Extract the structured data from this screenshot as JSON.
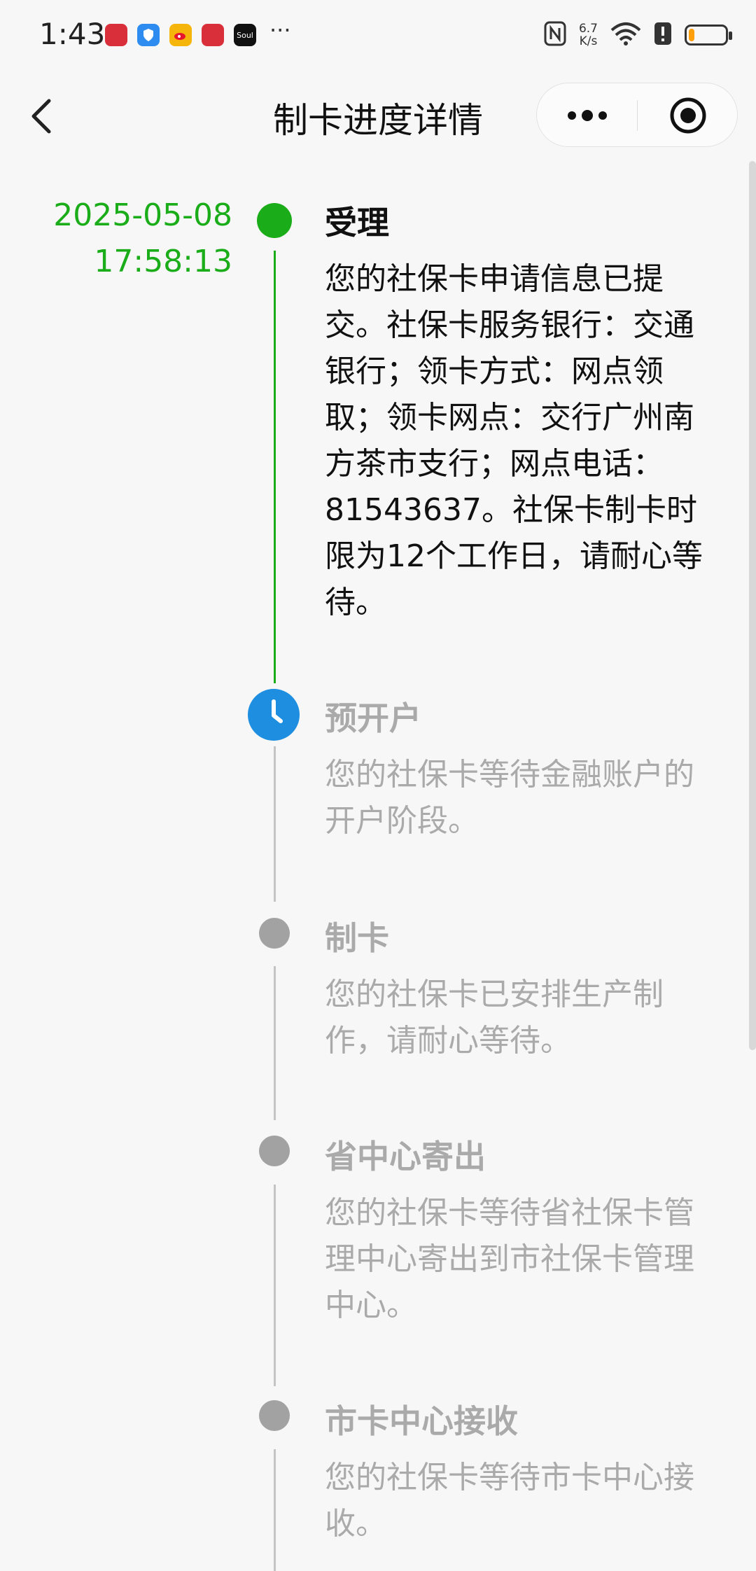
{
  "status_bar": {
    "time": "1:43",
    "dots": "···",
    "net_speed_value": "6.7",
    "net_speed_unit": "K/s",
    "icons": [
      "nfc-icon",
      "wifi-icon",
      "alert-icon",
      "battery-icon"
    ],
    "battery_level": 0.15,
    "battery_color": "#ff9f0a",
    "app_soul_label": "Soul"
  },
  "header": {
    "title": "制卡进度详情",
    "back_icon": "chevron-left-icon",
    "more_icon": "more-dots-icon",
    "close_icon": "target-close-icon"
  },
  "colors": {
    "done": "#1aad19",
    "current": "#1e8fe0",
    "pending": "#a2a2a2"
  },
  "steps": [
    {
      "status": "done",
      "date": "2025-05-08",
      "time": "17:58:13",
      "title": "受理",
      "desc": "您的社保卡申请信息已提交。社保卡服务银行：交通银行；领卡方式：网点领取；领卡网点：交行广州南方茶市支行；网点电话：81543637。社保卡制卡时限为12个工作日，请耐心等待。"
    },
    {
      "status": "current",
      "title": "预开户",
      "desc": "您的社保卡等待金融账户的开户阶段。"
    },
    {
      "status": "pending",
      "title": "制卡",
      "desc": "您的社保卡已安排生产制作，请耐心等待。"
    },
    {
      "status": "pending",
      "title": "省中心寄出",
      "desc": "您的社保卡等待省社保卡管理中心寄出到市社保卡管理中心。"
    },
    {
      "status": "pending",
      "title": "市卡中心接收",
      "desc": "您的社保卡等待市卡中心接收。"
    }
  ]
}
